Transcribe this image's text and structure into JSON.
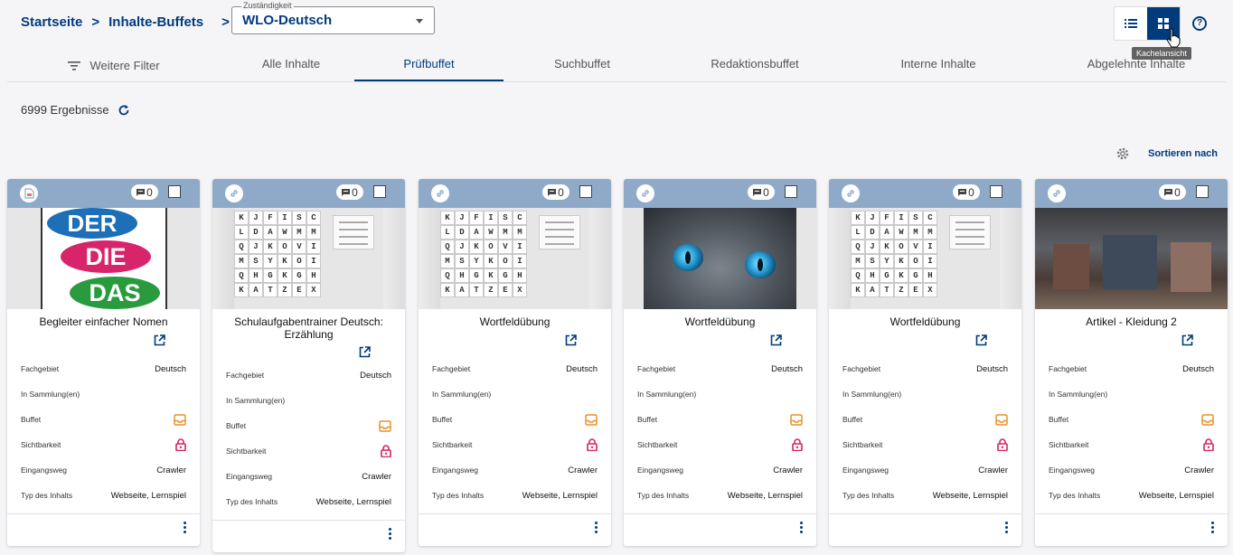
{
  "breadcrumb": {
    "home": "Startseite",
    "current": "Inhalte-Buffets"
  },
  "zustaendigkeit": {
    "label": "Zuständigkeit",
    "value": "WLO-Deutsch"
  },
  "view": {
    "tooltip": "Kachelansicht",
    "active": "tile"
  },
  "tabs": [
    {
      "label": "Weitere Filter"
    },
    {
      "label": "Alle Inhalte"
    },
    {
      "label": "Prüfbuffet"
    },
    {
      "label": "Suchbuffet"
    },
    {
      "label": "Redaktionsbuffet"
    },
    {
      "label": "Interne Inhalte"
    },
    {
      "label": "Abgelehnte Inhalte"
    }
  ],
  "results": {
    "count_text": "6999 Ergebnisse"
  },
  "sort": {
    "label": "Sortieren nach"
  },
  "meta_labels": {
    "fachgebiet": "Fachgebiet",
    "sammlung": "In Sammlung(en)",
    "buffet": "Buffet",
    "sichtbarkeit": "Sichtbarkeit",
    "eingangsweg": "Eingangsweg",
    "typ": "Typ des Inhalts"
  },
  "word_grid": [
    "K",
    "J",
    "F",
    "I",
    "S",
    "C",
    "L",
    "D",
    "A",
    "W",
    "M",
    "M",
    "Q",
    "J",
    "K",
    "O",
    "V",
    "I",
    "M",
    "S",
    "Y",
    "K",
    "O",
    "I",
    "Q",
    "H",
    "G",
    "K",
    "G",
    "H",
    "K",
    "A",
    "T",
    "Z",
    "E",
    "X"
  ],
  "derdiedas": [
    "DER",
    "DIE",
    "DAS"
  ],
  "cards": [
    {
      "title": "Begleiter einfacher Nomen",
      "comments": "0",
      "fachgebiet": "Deutsch",
      "eingangsweg": "Crawler",
      "typ": "Webseite, Lernspiel",
      "type_icon": "file-icon",
      "thumb": "derdiedas"
    },
    {
      "title": "Schulaufgabentrainer Deutsch: Erzählung",
      "comments": "0",
      "fachgebiet": "Deutsch",
      "eingangsweg": "Crawler",
      "typ": "Webseite, Lernspiel",
      "type_icon": "link-icon",
      "thumb": "wordgrid"
    },
    {
      "title": "Wortfeldübung",
      "comments": "0",
      "fachgebiet": "Deutsch",
      "eingangsweg": "Crawler",
      "typ": "Webseite, Lernspiel",
      "type_icon": "link-icon",
      "thumb": "wordgrid"
    },
    {
      "title": "Wortfeldübung",
      "comments": "0",
      "fachgebiet": "Deutsch",
      "eingangsweg": "Crawler",
      "typ": "Webseite, Lernspiel",
      "type_icon": "link-icon",
      "thumb": "cat"
    },
    {
      "title": "Wortfeldübung",
      "comments": "0",
      "fachgebiet": "Deutsch",
      "eingangsweg": "Crawler",
      "typ": "Webseite, Lernspiel",
      "type_icon": "link-icon",
      "thumb": "wordgrid"
    },
    {
      "title": "Artikel - Kleidung 2",
      "comments": "0",
      "fachgebiet": "Deutsch",
      "eingangsweg": "Crawler",
      "typ": "Webseite, Lernspiel",
      "type_icon": "link-icon",
      "thumb": "store"
    }
  ],
  "colors": {
    "primary": "#003b7c",
    "card_header": "#8fa9c9",
    "buffet_icon": "#e8912a",
    "lock_icon": "#d6245c"
  }
}
